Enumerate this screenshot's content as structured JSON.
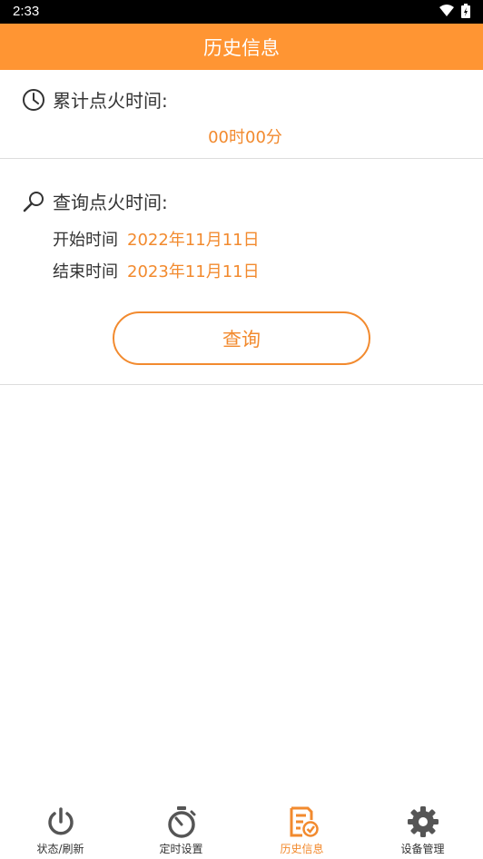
{
  "status_bar": {
    "time": "2:33"
  },
  "header": {
    "title": "历史信息"
  },
  "total_ignition": {
    "label": "累计点火时间:",
    "value": "00时00分"
  },
  "query_ignition": {
    "label": "查询点火时间:",
    "start_label": "开始时间",
    "start_date": "2022年11月11日",
    "end_label": "结束时间",
    "end_date": "2023年11月11日",
    "button_label": "查询"
  },
  "bottom_nav": {
    "items": [
      {
        "label": "状态/刷新",
        "icon": "power-icon",
        "active": false
      },
      {
        "label": "定时设置",
        "icon": "stopwatch-icon",
        "active": false
      },
      {
        "label": "历史信息",
        "icon": "history-document-icon",
        "active": true
      },
      {
        "label": "设备管理",
        "icon": "gear-icon",
        "active": false
      }
    ]
  },
  "colors": {
    "header": "#FF9533",
    "accent": "#F28A2E",
    "nav_icon": "#555555"
  }
}
